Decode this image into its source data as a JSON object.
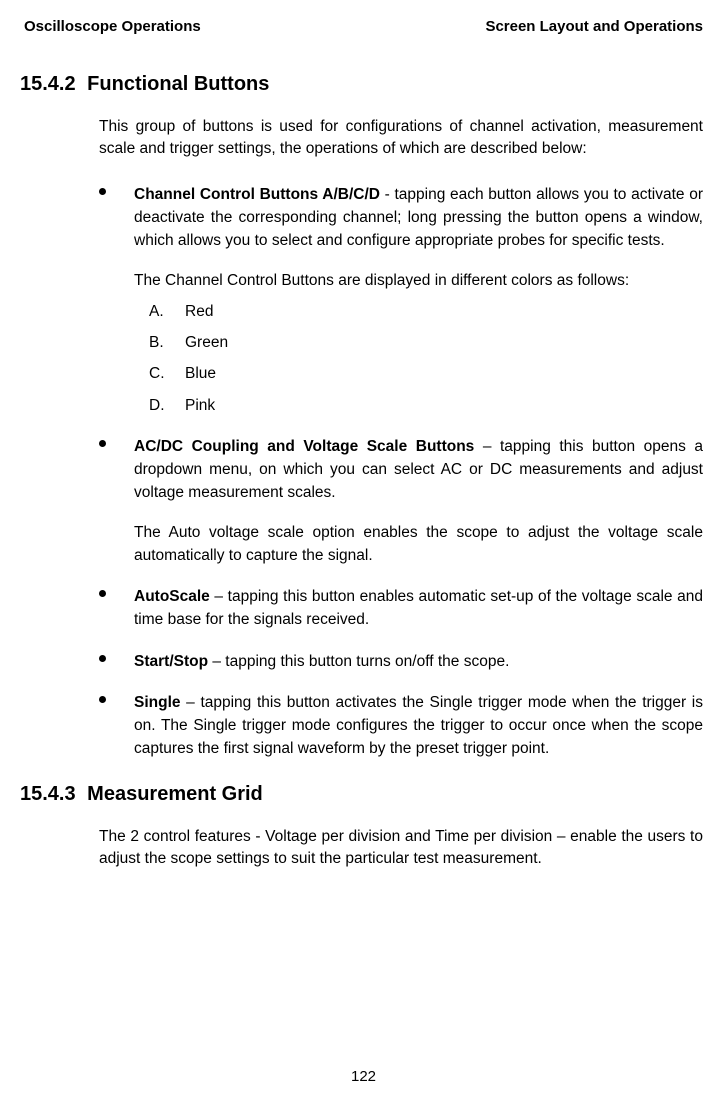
{
  "header": {
    "left": "Oscilloscope Operations",
    "right": "Screen Layout and Operations"
  },
  "section1": {
    "number": "15.4.2",
    "title": "Functional Buttons",
    "intro": "This group of buttons is used for configurations of channel activation, measurement scale and trigger settings, the operations of which are described below:"
  },
  "bullets": {
    "channelControl": {
      "lead": "Channel Control Buttons A/B/C/D",
      "body": " - tapping each button allows you to activate or deactivate the corresponding channel; long pressing the button opens a window, which allows you to select and configure appropriate probes for specific tests.",
      "subpara": "The Channel Control Buttons are displayed in different colors as follows:",
      "colors": {
        "a": {
          "letter": "A.",
          "name": "Red"
        },
        "b": {
          "letter": "B.",
          "name": "Green"
        },
        "c": {
          "letter": "C.",
          "name": "Blue"
        },
        "d": {
          "letter": "D.",
          "name": "Pink"
        }
      }
    },
    "acdc": {
      "lead": "AC/DC Coupling and Voltage Scale Buttons",
      "body": " – tapping this button opens a dropdown menu, on which you can select AC or DC measurements and adjust voltage measurement scales.",
      "subpara": "The Auto voltage scale option enables the scope to adjust the voltage scale automatically to capture the signal."
    },
    "autoscale": {
      "lead": "AutoScale",
      "body": " – tapping this button enables automatic set-up of the voltage scale and time base for the signals received."
    },
    "startstop": {
      "lead": "Start/Stop",
      "body": " – tapping this button turns on/off the scope."
    },
    "single": {
      "lead": "Single",
      "body": " – tapping this button activates the Single trigger mode when the trigger is on. The Single trigger mode configures the trigger to occur once when the scope captures the first signal waveform by the preset trigger point."
    }
  },
  "section2": {
    "number": "15.4.3",
    "title": "Measurement Grid",
    "intro": "The 2 control features - Voltage per division and Time per division – enable the users to adjust the scope settings to suit the particular test measurement."
  },
  "pageNumber": "122"
}
